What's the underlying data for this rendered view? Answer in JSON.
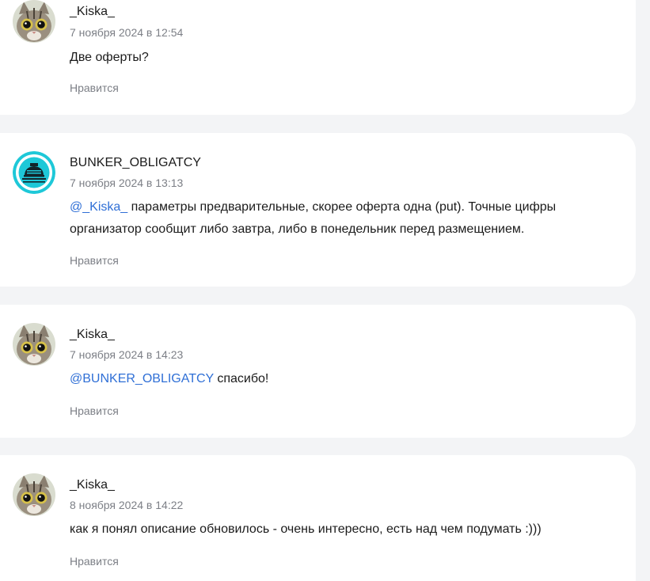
{
  "comments": [
    {
      "author": "_Kiska_",
      "date": "7 ноября 2024 в 12:54",
      "mention": "",
      "text": "Две оферты?",
      "like_label": "Нравится",
      "avatar": "cat-avatar"
    },
    {
      "author": "BUNKER_OBLIGATCY",
      "date": "7 ноября 2024 в 13:13",
      "mention": "@_Kiska_",
      "text": " параметры предварительные, скорее оферта одна (put). Точные цифры организатор сообщит либо завтра, либо в понедельник перед размещением.",
      "like_label": "Нравится",
      "avatar": "bunker-avatar"
    },
    {
      "author": "_Kiska_",
      "date": "7 ноября 2024 в 14:23",
      "mention": "@BUNKER_OBLIGATCY",
      "text": " спасибо!",
      "like_label": "Нравится",
      "avatar": "cat-avatar"
    },
    {
      "author": "_Kiska_",
      "date": "8 ноября 2024 в 14:22",
      "mention": "",
      "text": "как я понял описание обновилось  - очень интересно, есть над чем подумать :)))",
      "like_label": "Нравится",
      "avatar": "cat-avatar"
    }
  ],
  "colors": {
    "page_background": "#f3f4f6",
    "card_background": "#ffffff",
    "mention": "#2f6fd6",
    "muted_text": "#7c7f86",
    "bunker_avatar_ring": "#1ec8d8"
  }
}
